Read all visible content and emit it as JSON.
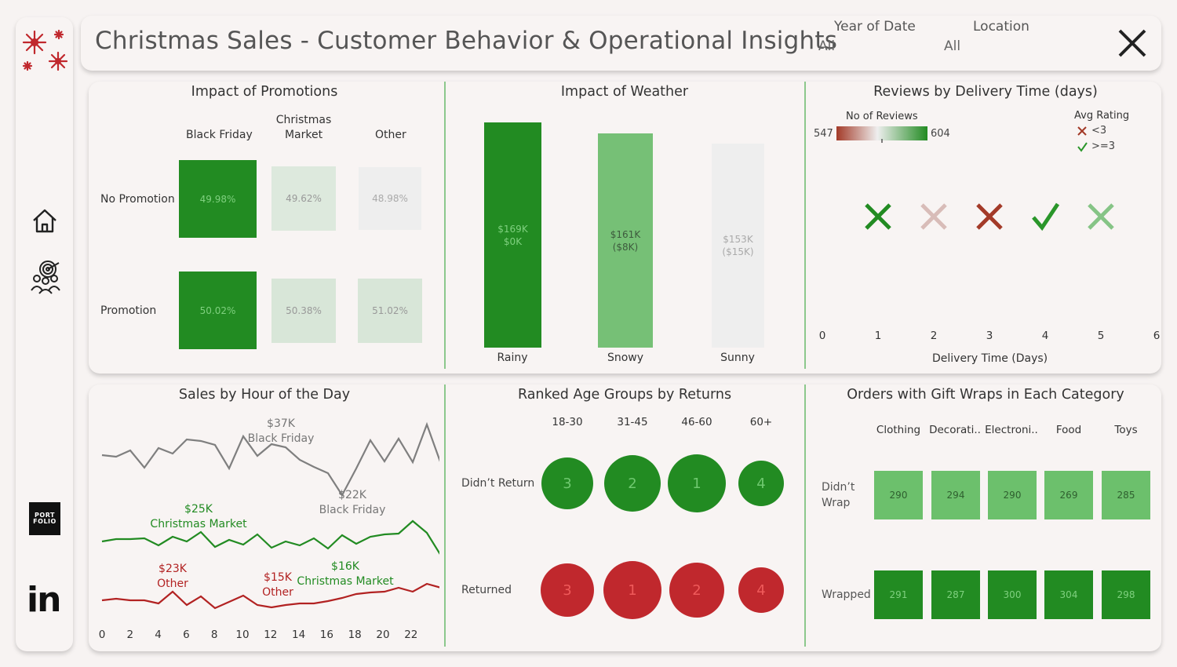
{
  "header": {
    "title": "Christmas Sales - Customer Behavior & Operational Insights",
    "filters": [
      {
        "label": "Year of Date",
        "value": "All"
      },
      {
        "label": "Location",
        "value": "All"
      }
    ]
  },
  "sidebar": {
    "items": [
      {
        "icon": "snowflake-logo-icon"
      },
      {
        "icon": "home-icon"
      },
      {
        "icon": "target-audience-icon"
      },
      {
        "icon": "portfolio-icon",
        "label_line1": "PORT",
        "label_line2": "FOLIO"
      },
      {
        "icon": "linkedin-icon",
        "label": "in"
      }
    ]
  },
  "promotions": {
    "title": "Impact of Promotions",
    "columns": [
      "Black Friday",
      "Christmas Market",
      "Other"
    ],
    "rows": [
      {
        "label": "No Promotion",
        "values": [
          "49.98%",
          "49.62%",
          "48.98%"
        ]
      },
      {
        "label": "Promotion",
        "values": [
          "50.02%",
          "50.38%",
          "51.02%"
        ]
      }
    ]
  },
  "weather": {
    "title": "Impact of Weather",
    "bars": [
      {
        "label": "Rainy",
        "value": "$169K",
        "diff": "$0K"
      },
      {
        "label": "Snowy",
        "value": "$161K",
        "diff": "($8K)"
      },
      {
        "label": "Sunny",
        "value": "$153K",
        "diff": "($15K)"
      }
    ]
  },
  "reviews": {
    "title": "Reviews by Delivery Time (days)",
    "legend_title": "No of Reviews",
    "legend_min": "547",
    "legend_max": "604",
    "rating_title": "Avg Rating",
    "rating_bad": "<3",
    "rating_good": ">=3",
    "xlabel": "Delivery Time (Days)",
    "ticks": [
      "0",
      "1",
      "2",
      "3",
      "4",
      "5",
      "6"
    ],
    "points": [
      {
        "day": 1,
        "mark": "x",
        "color": "#228b22"
      },
      {
        "day": 2,
        "mark": "x",
        "color": "#d8bcb8"
      },
      {
        "day": 3,
        "mark": "x",
        "color": "#a33a28"
      },
      {
        "day": 4,
        "mark": "check",
        "color": "#2a962a"
      },
      {
        "day": 5,
        "mark": "x",
        "color": "#86c486"
      }
    ]
  },
  "hourly": {
    "title": "Sales by Hour of the Day",
    "ticks": [
      "0",
      "2",
      "4",
      "6",
      "8",
      "10",
      "12",
      "14",
      "16",
      "18",
      "20",
      "22"
    ],
    "annotations": [
      {
        "value": "$37K",
        "label": "Black Friday",
        "color": "#777777"
      },
      {
        "value": "$22K",
        "label": "Black Friday",
        "color": "#777777"
      },
      {
        "value": "$25K",
        "label": "Christmas Market",
        "color": "#228b22"
      },
      {
        "value": "$16K",
        "label": "Christmas Market",
        "color": "#228b22"
      },
      {
        "value": "$23K",
        "label": "Other",
        "color": "#b22222"
      },
      {
        "value": "$15K",
        "label": "Other",
        "color": "#b22222"
      }
    ]
  },
  "returns": {
    "title": "Ranked Age Groups by Returns",
    "columns": [
      "18-30",
      "31-45",
      "46-60",
      "60+"
    ],
    "rows": [
      {
        "label": "Didn’t Return",
        "ranks": [
          "3",
          "2",
          "1",
          "4"
        ]
      },
      {
        "label": "Returned",
        "ranks": [
          "3",
          "1",
          "2",
          "4"
        ]
      }
    ]
  },
  "giftwrap": {
    "title": "Orders with Gift Wraps in Each Category",
    "columns": [
      "Clothing",
      "Decorati..",
      "Electroni..",
      "Food",
      "Toys"
    ],
    "rows": [
      {
        "label_line1": "Didn’t",
        "label_line2": "Wrap",
        "values": [
          "290",
          "294",
          "290",
          "269",
          "285"
        ]
      },
      {
        "label_line1": "Wrapped",
        "label_line2": "",
        "values": [
          "291",
          "287",
          "300",
          "304",
          "298"
        ]
      }
    ]
  },
  "colors": {
    "dark_green": "#228b22",
    "mid_green": "#76c076",
    "light_green": "#dde9dd",
    "red": "#c0282d",
    "grey_line": "#7f7f7f"
  }
}
